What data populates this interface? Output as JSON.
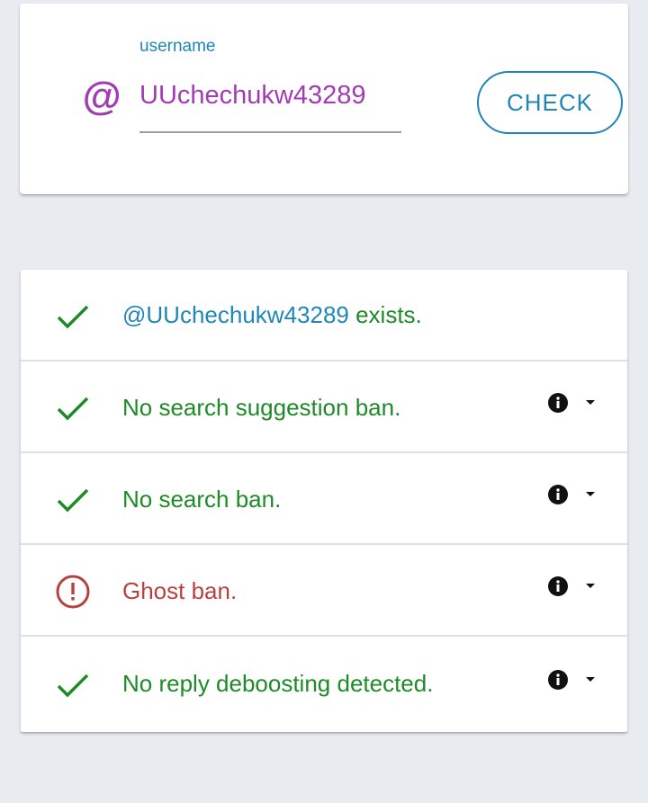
{
  "form": {
    "label": "username",
    "value": "UUchechukw43289",
    "check_label": "CHECK",
    "at_symbol": "@"
  },
  "results": {
    "exists": {
      "mention": "@UUchechukw43289",
      "text": " exists.",
      "status": "ok"
    },
    "search_suggestion": {
      "text": "No search suggestion ban.",
      "status": "ok"
    },
    "search": {
      "text": "No search ban.",
      "status": "ok"
    },
    "ghost": {
      "text": "Ghost ban.",
      "status": "bad"
    },
    "reply": {
      "text": "No reply deboosting detected.",
      "status": "ok"
    }
  },
  "colors": {
    "accent": "#1e86b8",
    "username": "#a23bb4",
    "ok": "#1f8a28",
    "bad": "#b8413f",
    "background": "#e8ecf0"
  },
  "icons": {
    "ok": "check-icon",
    "bad": "alert-circle-icon",
    "info": "info-icon",
    "expand": "caret-down-icon"
  }
}
